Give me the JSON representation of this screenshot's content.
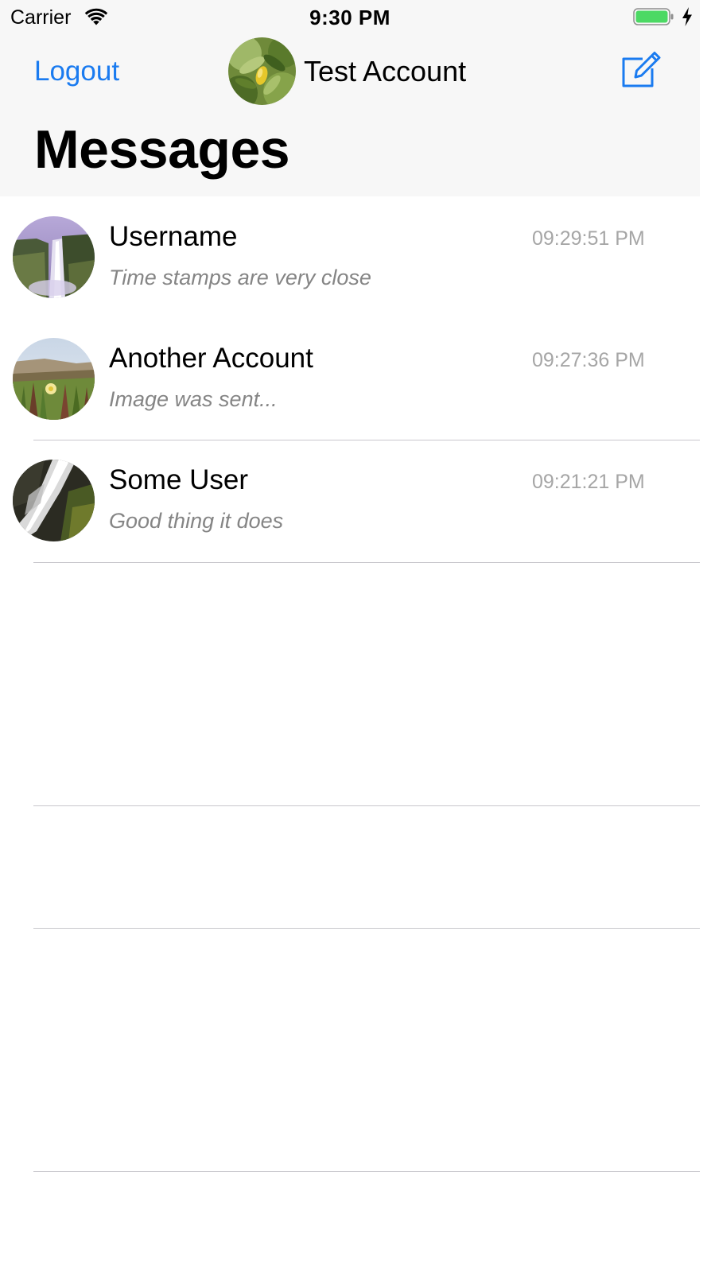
{
  "status_bar": {
    "carrier": "Carrier",
    "time": "9:30 PM",
    "wifi_icon": "wifi-icon",
    "battery_icon": "battery-charging-icon",
    "battery_color": "#4cd964"
  },
  "nav": {
    "logout_label": "Logout",
    "account_name": "Test Account",
    "compose_icon": "compose-icon",
    "title": "Messages",
    "accent_color": "#1a7bf0"
  },
  "conversations": [
    {
      "name": "Username",
      "time": "09:29:51 PM",
      "preview": "Time stamps are very close",
      "avatar": "waterfall-photo"
    },
    {
      "name": "Another Account",
      "time": "09:27:36 PM",
      "preview": "Image was sent...",
      "avatar": "flower-field-photo"
    },
    {
      "name": "Some User",
      "time": "09:21:21 PM",
      "preview": "Good thing it does",
      "avatar": "stream-photo"
    }
  ]
}
